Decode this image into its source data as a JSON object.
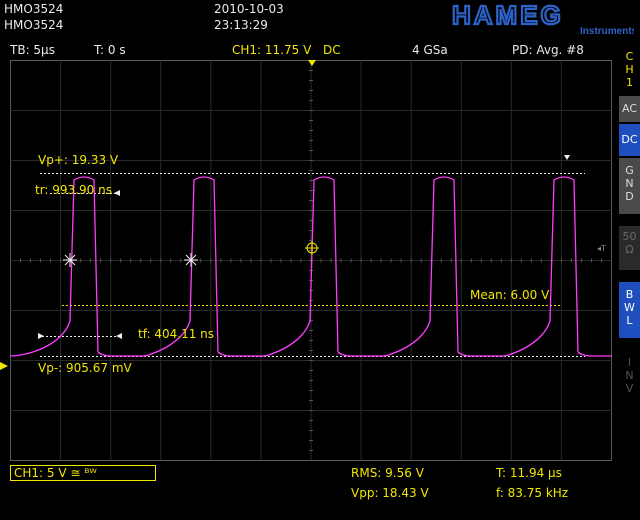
{
  "header": {
    "device_line1": "HMO3524",
    "device_line2": "HMO3524",
    "date": "2010-10-03",
    "time": "23:13:29",
    "brand": "HAMEG",
    "brand_sub": "Instruments"
  },
  "status_bar": {
    "timebase": "TB: 5µs",
    "trigger_time": "T: 0 s",
    "channel_setting": "CH1: 11.75 V",
    "coupling": "DC",
    "sample_rate": "4 GSa",
    "acquisition": "PD: Avg. #8"
  },
  "side_menu": {
    "channel": "C\nH\n1",
    "ac": "AC",
    "dc": "DC",
    "gnd": "G\nN\nD",
    "fifty": "50\nΩ",
    "bwl": "B\nW\nL",
    "inv": "I\nN\nV"
  },
  "measurements": {
    "vp_plus": "Vp+: 19.33 V",
    "tr": "tr: 993.90 ns",
    "tf": "tf: 404.11 ns",
    "vp_minus": "Vp-: 905.67 mV",
    "mean": "Mean: 6.00 V",
    "rms": "RMS: 9.56 V",
    "vpp": "Vpp: 18.43 V",
    "period": "T: 11.94 µs",
    "frequency": "f: 83.75 kHz"
  },
  "channel_label": "CH1: 5 V ≅ ᴮᵂ",
  "colors": {
    "trace": "#ff3cff",
    "trace_dim": "#a01fa0",
    "accent_yellow": "#f2e600",
    "grid": "#2b2b2b",
    "side_active": "#1f4fbf",
    "side_inactive": "#4a4a4a",
    "brand_blue": "#2c63c9"
  }
}
